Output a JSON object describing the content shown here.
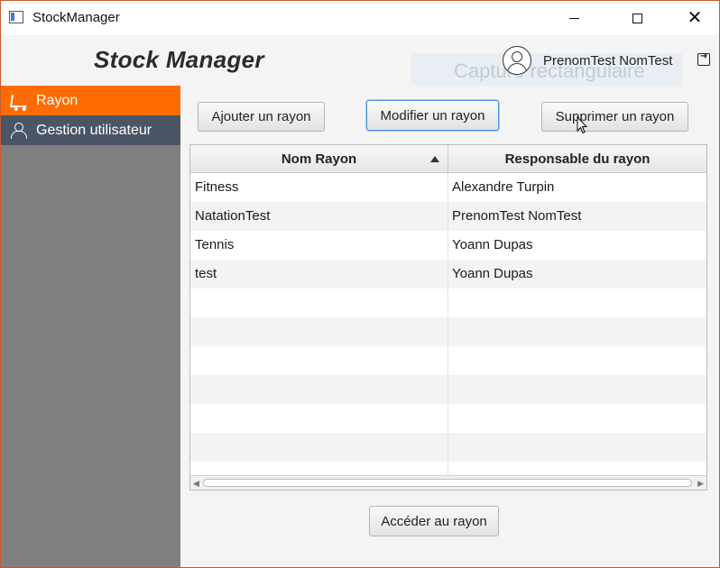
{
  "window": {
    "title": "StockManager",
    "controls": {
      "minimize": "minimize",
      "maximize": "maximize",
      "close": "✕"
    }
  },
  "header": {
    "brand": "Stock Manager",
    "ghost_overlay_text": "Capture rectangulaire",
    "user_name": "PrenomTest NomTest"
  },
  "sidebar": {
    "items": [
      {
        "label": "Rayon",
        "icon": "cart-icon",
        "active": true
      },
      {
        "label": "Gestion utilisateur",
        "icon": "user-icon",
        "active": false
      }
    ]
  },
  "toolbar": {
    "add_label": "Ajouter un rayon",
    "modify_label": "Modifier un rayon",
    "delete_label": "Supprimer un rayon"
  },
  "table": {
    "columns": [
      "Nom Rayon",
      "Responsable du rayon"
    ],
    "sort": {
      "column": "Nom Rayon",
      "direction": "ascending"
    },
    "rows": [
      {
        "name": "Fitness",
        "manager": "Alexandre Turpin"
      },
      {
        "name": "NatationTest",
        "manager": "PrenomTest NomTest"
      },
      {
        "name": "Tennis",
        "manager": "Yoann Dupas"
      },
      {
        "name": "test",
        "manager": "Yoann Dupas"
      }
    ],
    "empty_rows": 6
  },
  "footer": {
    "access_label": "Accéder au rayon"
  },
  "colors": {
    "accent": "#ff6b00",
    "sidebar_bg": "#7f7f7f",
    "sidebar_secondary": "#4a5566",
    "focus": "#4a90d9"
  }
}
